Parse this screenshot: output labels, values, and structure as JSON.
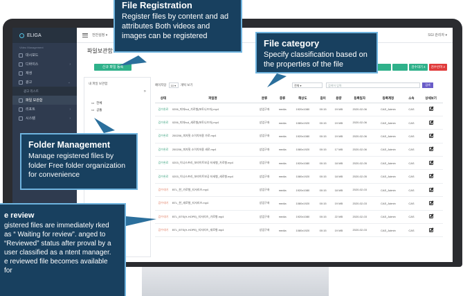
{
  "app": {
    "logo": "ELIGA",
    "sidebar_sub": "Video Management",
    "user": "SGI 관리자 ▾",
    "breadcrumb": "전반설정 ▾",
    "page_title": "파일보관함"
  },
  "sidebar": {
    "items": [
      {
        "label": "대시보드"
      },
      {
        "label": "디바이스"
      },
      {
        "label": "재생"
      },
      {
        "label": "광고"
      },
      {
        "label": "광고 리스트"
      },
      {
        "label": "파일 보관함"
      },
      {
        "label": "리포트"
      },
      {
        "label": "시스템"
      }
    ]
  },
  "toolbar": {
    "register_button": "신규 파일 등록",
    "per_page_label": "페이지당",
    "per_page_value": "10",
    "per_page_suffix": "개씩 보기",
    "category_value": "전체",
    "search_placeholder": "검색어 입력",
    "search_button": "검색"
  },
  "stats": [
    {
      "label": "",
      "color": "#2fb18a"
    },
    {
      "label": "",
      "color": "#2fb18a"
    },
    {
      "label": "검수대기 4",
      "color": "#2fb18a"
    },
    {
      "label": "검수반려 2",
      "color": "#e03b3b"
    }
  ],
  "folders": {
    "title": "내 파일 보관함",
    "collapse": "»",
    "items": [
      "전체",
      "공통"
    ]
  },
  "table": {
    "headers": [
      "상태",
      "파일명",
      "분류",
      "종류",
      "해상도",
      "길이",
      "용량",
      "등록일자",
      "등록계정",
      "소속",
      "상세보기"
    ],
    "rows": [
      {
        "status": "검수완료",
        "kind": "ok",
        "file": "0206_피자hut_가로형(포토니즈자).mp4",
        "cat": "상업구좌",
        "type": "media",
        "res": "1920x1080",
        "len": "00:15",
        "size": "19 MB",
        "date": "2020-02-06",
        "acct": "CAS_Admin",
        "org": "CAS"
      },
      {
        "status": "검수완료",
        "kind": "ok",
        "file": "0206_피자hut_세로형(포토니즈자).mp4",
        "cat": "상업구좌",
        "type": "media",
        "res": "1080x1920",
        "len": "00:15",
        "size": "19 MB",
        "date": "2020-02-06",
        "acct": "CAS_Admin",
        "org": "CAS"
      },
      {
        "status": "검수완료",
        "kind": "ok",
        "file": "200206_피자헛 소이치저용 가로.mp4",
        "cat": "상업구좌",
        "type": "media",
        "res": "1920x1080",
        "len": "00:15",
        "size": "19 MB",
        "date": "2020-02-06",
        "acct": "CAS_Admin",
        "org": "CAS"
      },
      {
        "status": "검수완료",
        "kind": "ok",
        "file": "200206_피자헛 소이치저용 세로.mp4",
        "cat": "상업구좌",
        "type": "media",
        "res": "1080x1920",
        "len": "00:15",
        "size": "17 MB",
        "date": "2020-02-06",
        "acct": "CAS_Admin",
        "org": "CAS"
      },
      {
        "status": "검수완료",
        "kind": "ok",
        "file": "0203_이니스프리_보라이트보공 터세형_가로형.mp4",
        "cat": "상업구좌",
        "type": "media",
        "res": "1920x1080",
        "len": "00:15",
        "size": "18 MB",
        "date": "2020-02-05",
        "acct": "CAS_Admin",
        "org": "CAS"
      },
      {
        "status": "검수완료",
        "kind": "ok",
        "file": "0203_이니스프리_보라이트보공 터세형_세로형.mp4",
        "cat": "상업구좌",
        "type": "media",
        "res": "1080x1920",
        "len": "00:15",
        "size": "18 MB",
        "date": "2020-02-05",
        "acct": "CAS_Admin",
        "org": "CAS"
      },
      {
        "status": "검수대기",
        "kind": "wait",
        "file": "BTL_한_가로형_티서리즈.mp4",
        "cat": "상업구좌",
        "type": "media",
        "res": "1920x1080",
        "len": "00:15",
        "size": "18 MB",
        "date": "2020-02-03",
        "acct": "CAS_Admin",
        "org": "CAS"
      },
      {
        "status": "검수대기",
        "kind": "wait",
        "file": "BTL_한_세로형_티서리즈.mp4",
        "cat": "상업구좌",
        "type": "media",
        "res": "1080x1920",
        "len": "00:15",
        "size": "19 MB",
        "date": "2020-02-03",
        "acct": "CAS_Admin",
        "org": "CAS"
      },
      {
        "status": "검수대기",
        "kind": "wait",
        "file": "BTL_BTS(H-HOPE)_티서리즈_가로형.mp4",
        "cat": "상업구좌",
        "type": "media",
        "res": "1920x1080",
        "len": "00:15",
        "size": "22 MB",
        "date": "2020-02-03",
        "acct": "CAS_Admin",
        "org": "CAS"
      },
      {
        "status": "검수대기",
        "kind": "wait",
        "file": "BTL_BTS(H-HOPE)_티서리즈_세로형.mp4",
        "cat": "상업구좌",
        "type": "media",
        "res": "1080x1920",
        "len": "00:15",
        "size": "19 MB",
        "date": "2020-02-03",
        "acct": "CAS_Admin",
        "org": "CAS"
      }
    ]
  },
  "callouts": {
    "registration": {
      "title": "File Registration",
      "body": "Register files by content and ad attributes Both videos and images can be registered"
    },
    "category": {
      "title": "File category",
      "body": "Specify classification based on the properties of the file"
    },
    "folder": {
      "title": "Folder Management",
      "body": "Manage registered files by folder Free folder organization for convenience"
    },
    "review": {
      "title": "e review",
      "body": "gistered files are immediately rked as “ Waiting for review”. anged to “Reviewed” status after proval by a user classified as a ntent manager. e reviewed file becomes available for"
    }
  },
  "colors": {
    "sidebar": "#2f3b4f",
    "accent": "#2fb18a",
    "callout": "#18405f",
    "callout_border": "#6fb4df"
  }
}
